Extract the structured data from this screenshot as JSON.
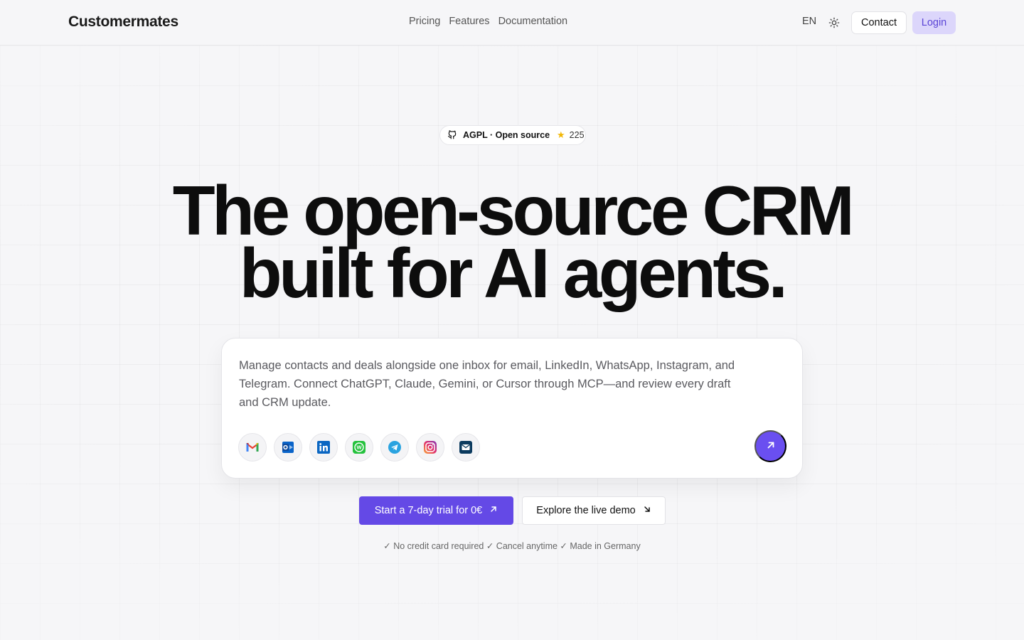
{
  "header": {
    "logo": "Customermates",
    "nav": [
      "Pricing",
      "Features",
      "Documentation"
    ],
    "language": "EN",
    "theme_icon": "sun-icon",
    "contact_label": "Contact",
    "login_label": "Login"
  },
  "badge": {
    "icon": "github-icon",
    "text": "AGPL · Open source",
    "star_icon": "star-icon",
    "count": "225"
  },
  "hero": {
    "headline_line1": "The open-source CRM",
    "headline_line2": "built for AI agents."
  },
  "prompt_card": {
    "text": "Manage contacts and deals alongside one inbox for email, LinkedIn, WhatsApp, Instagram, and Telegram. Connect ChatGPT, Claude, Gemini, or Cursor through MCP—and review every draft and CRM update.",
    "channels": [
      "gmail-icon",
      "outlook-icon",
      "linkedin-icon",
      "whatsapp-icon",
      "telegram-icon",
      "instagram-icon",
      "mail-icon"
    ],
    "send_icon": "arrow-up-right-icon"
  },
  "cta": {
    "primary_label": "Start a 7-day trial for 0€",
    "secondary_label": "Explore the live demo"
  },
  "footnote": "✓ No credit card required ✓ Cancel anytime ✓ Made in Germany",
  "colors": {
    "accent": "#6449e6",
    "login_bg": "#dcd6fb",
    "background": "#f6f6f8"
  }
}
